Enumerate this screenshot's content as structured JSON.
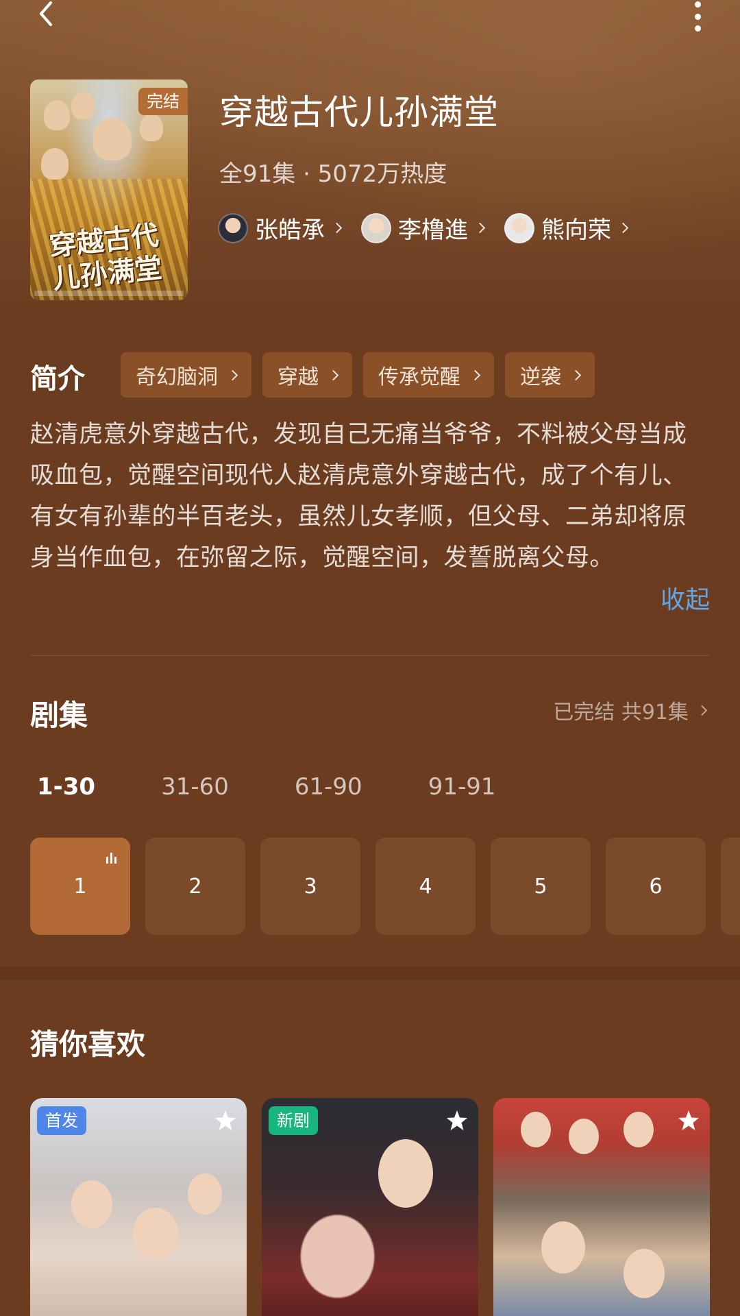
{
  "header": {
    "title": "穿越古代儿孙满堂",
    "status_badge": "完结",
    "poster_title": "穿越古代儿孙满堂",
    "meta": "全91集 · 5072万热度",
    "cast": [
      {
        "name": "张皓承"
      },
      {
        "name": "李橹進"
      },
      {
        "name": "熊向荣"
      }
    ]
  },
  "intro": {
    "label": "简介",
    "tags": [
      "奇幻脑洞",
      "穿越",
      "传承觉醒",
      "逆袭"
    ],
    "description": "赵清虎意外穿越古代，发现自己无痛当爷爷，不料被父母当成吸血包，觉醒空间现代人赵清虎意外穿越古代，成了个有儿、有女有孙辈的半百老头，虽然儿女孝顺，但父母、二弟却将原身当作血包，在弥留之际，觉醒空间，发誓脱离父母。",
    "collapse_label": "收起"
  },
  "episodes": {
    "label": "剧集",
    "status": "已完结 共91集",
    "ranges": [
      "1-30",
      "31-60",
      "61-90",
      "91-91"
    ],
    "active_range": "1-30",
    "items": [
      "1",
      "2",
      "3",
      "4",
      "5",
      "6"
    ],
    "playing": "1"
  },
  "recommend": {
    "label": "猜你喜欢",
    "cards": [
      {
        "badge": "首发",
        "badge_color": "#4f86e8"
      },
      {
        "badge": "新剧",
        "badge_color": "#18b57f"
      },
      {
        "badge": "",
        "badge_color": ""
      }
    ]
  },
  "colors": {
    "background": "#6b3c1f",
    "accent": "#b26a37",
    "link": "#5fa7e8"
  },
  "icons": [
    "back-arrow-icon",
    "more-vertical-icon",
    "chevron-right-icon",
    "playing-bars-icon",
    "star-icon"
  ]
}
